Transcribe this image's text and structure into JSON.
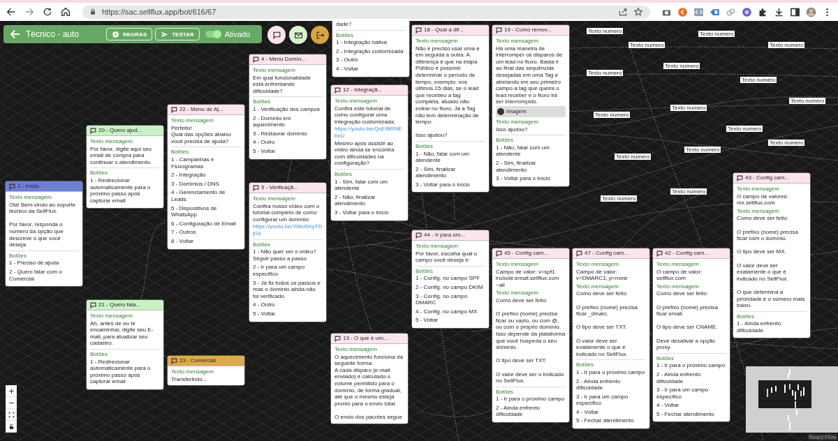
{
  "browser": {
    "url": "https://sac.sellflux.app/bot/616/67"
  },
  "header": {
    "title": "Técnico - auto",
    "buttons": [
      {
        "kind": "rules",
        "label": "REGRAS"
      },
      {
        "kind": "test",
        "label": "TESTAR"
      }
    ],
    "toggle": {
      "on": true,
      "label": "Ativado"
    }
  },
  "actions": [
    {
      "kind": "chat",
      "color": "#fce4ec"
    },
    {
      "kind": "mail",
      "color": "#d9f5d0"
    },
    {
      "kind": "exit",
      "color": "#d9a441"
    }
  ],
  "nodes": [
    {
      "color": "#ffffff",
      "blocks": [
        {
          "text": "dade?"
        }
      ],
      "buttons_label": "Botões",
      "options": [
        "1 - Integração nativa",
        "2 - Integração customizada",
        "3 - Outro",
        "4 - Voltar"
      ]
    },
    {
      "title": "4 - Menu Domín...",
      "color": "#fde4ee",
      "blocks": [
        {
          "label": "Texto mensagem",
          "text": "Em qual funcionalidade está enfrentando dificuldade?"
        }
      ],
      "buttons_label": "Botões",
      "options": [
        "1 - Verificação dos campos",
        "2 - Domínio em aquecimento",
        "3 - Restaurar domínio",
        "4 - Outro",
        "5 - Voltar"
      ]
    },
    {
      "title": "22 - Menu de Aj...",
      "color": "#fde4ee",
      "blocks": [
        {
          "label": "Texto mensagem",
          "text": "Perfeito!\nQual das opções abaixo você precisa de ajuda?"
        }
      ],
      "buttons_label": "Botões",
      "options": [
        "1 - Campanhas e Fluxogramas",
        "2 - Integração",
        "3 - Domínios / DNS",
        "4 - Gerenciamento de Leads",
        "5 - Dispositivos de WhatsApp",
        "6 - Configuração de Email",
        "7 - Outros",
        "8 - Voltar"
      ]
    },
    {
      "title": "20 - Quero ajud...",
      "color": "#c9f2c4",
      "blocks": [
        {
          "label": "Texto mensagem",
          "text": "Por favor, digite aqui seu email de compra para continuar o atendimento."
        }
      ],
      "buttons_label": "Botões",
      "options": [
        "1 - Redirecionar automaticamente para o próximo passo após capturar email"
      ]
    },
    {
      "title": "1 - Início",
      "color": "#6b7fd7",
      "blocks": [
        {
          "label": "Texto mensagem",
          "text": "Olá! Bem-vindo ao suporte técnico da SellFlux.\n\nPor favor, responda o número da opção que descreve o que você deseja:"
        }
      ],
      "buttons_label": "Botões",
      "options": [
        "1 - Preciso de ajuda",
        "2 - Quero falar com o Comercial"
      ]
    },
    {
      "title": "5 - Verificaçã...",
      "color": "#fde4ee",
      "blocks": [
        {
          "label": "Texto mensagem",
          "text": "Confira nosso vídeo com o tutorial completo de como configurar um domínio:",
          "link": "https://youtu.be/YWuSKyTDjGs"
        }
      ],
      "buttons_label": "Botões",
      "options": [
        "1 - Não quer ver o vídeo? Seguir passo a passo",
        "2 - Ir para um campo específico",
        "3 - Já fiz todos os passos e mas o domínio ainda não foi verificado",
        "4 - Outro",
        "5 - Voltar"
      ]
    },
    {
      "title": "12 - Integraçã...",
      "color": "#fde4ee",
      "blocks": [
        {
          "label": "Texto mensagem",
          "text": "Confira este tutorial de como configurar uma integração customizada:",
          "link": "https://youtu.be/QoEf8RNEbvU",
          "after": "Mesmo após assistir ao vídeo ainda se encontra com dificuldades na configuração?"
        }
      ],
      "buttons_label": "Botões",
      "options": [
        "1 - Sim, falar com um atendente",
        "2 - Não, finalizar atendimento",
        "3 - Voltar para o início"
      ]
    },
    {
      "title": "18 - Qual a dif...",
      "color": "#fde4ee",
      "blocks": [
        {
          "label": "Texto mensagem",
          "text": "Não é preciso usar uma e em seguida a outra. A diferença é que na etapa Público é possível determinar o período de tempo, exemplo: nos últimos 15 dias, se o lead que recebeu a tag completa, atuado não entrar no fluxo. Já a Tag não tem determinação de tempo.\n\nIsso ajudou?"
        }
      ],
      "buttons_label": "Botões",
      "options": [
        "1 - Não, falar com um atendente",
        "2 - Sim, finalizar atendimento",
        "3 - Voltar para o início"
      ]
    },
    {
      "title": "19 - Como remov...",
      "color": "#fde4ee",
      "blocks": [
        {
          "label": "Texto mensagem",
          "text": "Há uma maneira de interromper os disparos de um lead no fluxo. Basta ir ao final das sequências desejadas em uma Tag e atrelando em seu primeiro campo a tag que queira o lead receber e o fluxo irá ser interrompido."
        },
        {
          "kind": "image",
          "text": "Imagem"
        },
        {
          "label": "Texto mensagem",
          "text": "Isso ajudou?"
        }
      ],
      "buttons_label": "Botões",
      "options": [
        "1 - Não, falar com um atendente",
        "2 - Sim, finalizar atendimento",
        "3 - Voltar para o início"
      ]
    },
    {
      "title": "21 - Quero fala...",
      "color": "#c9f2c4",
      "blocks": [
        {
          "label": "Texto mensagem",
          "text": "Ah, antes de eu te encaminhar, digite seu E-mail, para atualizar seu cadastro."
        }
      ],
      "buttons_label": "Botões",
      "options": [
        "1 - Redirecionar automaticamente para o próximo passo após capturar email"
      ]
    },
    {
      "title": "23 - Comercial",
      "color": "#e0a94b",
      "blocks": [
        {
          "label": "Texto mensagem",
          "text": "Transferindo..."
        }
      ]
    },
    {
      "title": "44 - Ir para um...",
      "color": "#fde4ee",
      "blocks": [
        {
          "label": "Texto mensagem",
          "text": "Por favor, escolha qual o campo você deseja ir:"
        }
      ],
      "buttons_label": "Botões",
      "options": [
        "1 - Config. no campo SPF",
        "2 - Config. no campo DKIM",
        "3 - Config. no campo DMARC",
        "4 - Config. no campo MX",
        "5 - Voltar"
      ]
    },
    {
      "title": "45 - Config cam...",
      "color": "#fde4ee",
      "blocks": [
        {
          "label": "Texto mensagem",
          "text": "Campo de valor: v=spf1 include:email.sellflux.com ~all"
        },
        {
          "label": "Texto mensagem",
          "text": "Como deve ser feito:\n\nO prefixo (nome) precisa ficar ou vazio, ou com @, ou com o próprio domínio. Isso depende da plataforma que você hospeda o seu domínio.\n\nO tipo deve ser TXT.\n\nO valor deve ser o indicado no SellFlux."
        }
      ],
      "buttons_label": "Botões",
      "options": [
        "1 - Ir para o próximo campo",
        "2 - Ainda enfrento dificuldade"
      ]
    },
    {
      "title": "47 - Config cam...",
      "color": "#fde4ee",
      "blocks": [
        {
          "label": "Texto mensagem",
          "text": "Campo de valor: v=DMARC1; p=none"
        },
        {
          "label": "Texto mensagem",
          "text": "Como deve ser feito:\n\nO prefixo (nome) precisa ficar _dmarc.\n\nO tipo deve ser TXT.\n\nO valor deve ser exatamente o que é indicado no SellFlux."
        }
      ],
      "buttons_label": "Botões",
      "options": [
        "1 - Ir para o próximo campo",
        "2 - Ainda enfrento dificuldade",
        "3 - Ir para um campo específico",
        "4 - Voltar",
        "5 - Fechar atendimento"
      ]
    },
    {
      "title": "42 - Config cam...",
      "color": "#fde4ee",
      "blocks": [
        {
          "label": "Texto mensagem",
          "text": "O campo de valor: sellflux.com"
        },
        {
          "label": "Texto mensagem",
          "text": "Como deve ser feito:\n\nO prefixo (nome) precisa ficar email.\n\nO tipo deve ser CNAME.\n\nDeve desativar a opção proxy."
        }
      ],
      "buttons_label": "Botões",
      "options": [
        "1 - Ir para o próximo campo",
        "2 - Ainda enfrento dificuldade",
        "3 - Ir para um campo específico",
        "4 - Voltar",
        "5 - Fechar atendimento"
      ]
    },
    {
      "title": "43 - Config cam...",
      "color": "#fde4ee",
      "blocks": [
        {
          "label": "Texto mensagem",
          "text": "O campo de valores: mx.sellflux.com"
        },
        {
          "label": "Texto mensagem",
          "text": "Como deve ser feito:\n\nO prefixo (nome) precisa ficar com o domínio.\n\nO tipo deve ser MX.\n\nO valor deve ser exatamente o que é indicado no SellFlux.\n\nO que determina a prioridade é o número mais baixo."
        }
      ],
      "buttons_label": "Botões",
      "options": [
        "1 - Ainda enfrento dificuldade"
      ]
    },
    {
      "title": "13 - O que é um...",
      "color": "#fde4ee",
      "blocks": [
        {
          "label": "Texto mensagem",
          "text": "O aquecimento funciona da seguinte forma:\nA cada disparo (e-mail enviado) é calculado o volume permitido para o domínio, de forma gradual, até que o mesmo esteja pronto para o envio total.\n\nO envio dos pacotes segue"
        }
      ]
    }
  ],
  "edge_labels": [
    "Texto numero",
    "Texto numero",
    "Texto numero",
    "Texto numero",
    "Texto numero",
    "Texto numero",
    "Texto numero",
    "Texto numero",
    "Texto numero",
    "Texto numero",
    "Texto numero",
    "Texto numero",
    "Texto numero",
    "Texto numero",
    "Texto numero",
    "Texto numero"
  ],
  "attribution": "React Flow"
}
